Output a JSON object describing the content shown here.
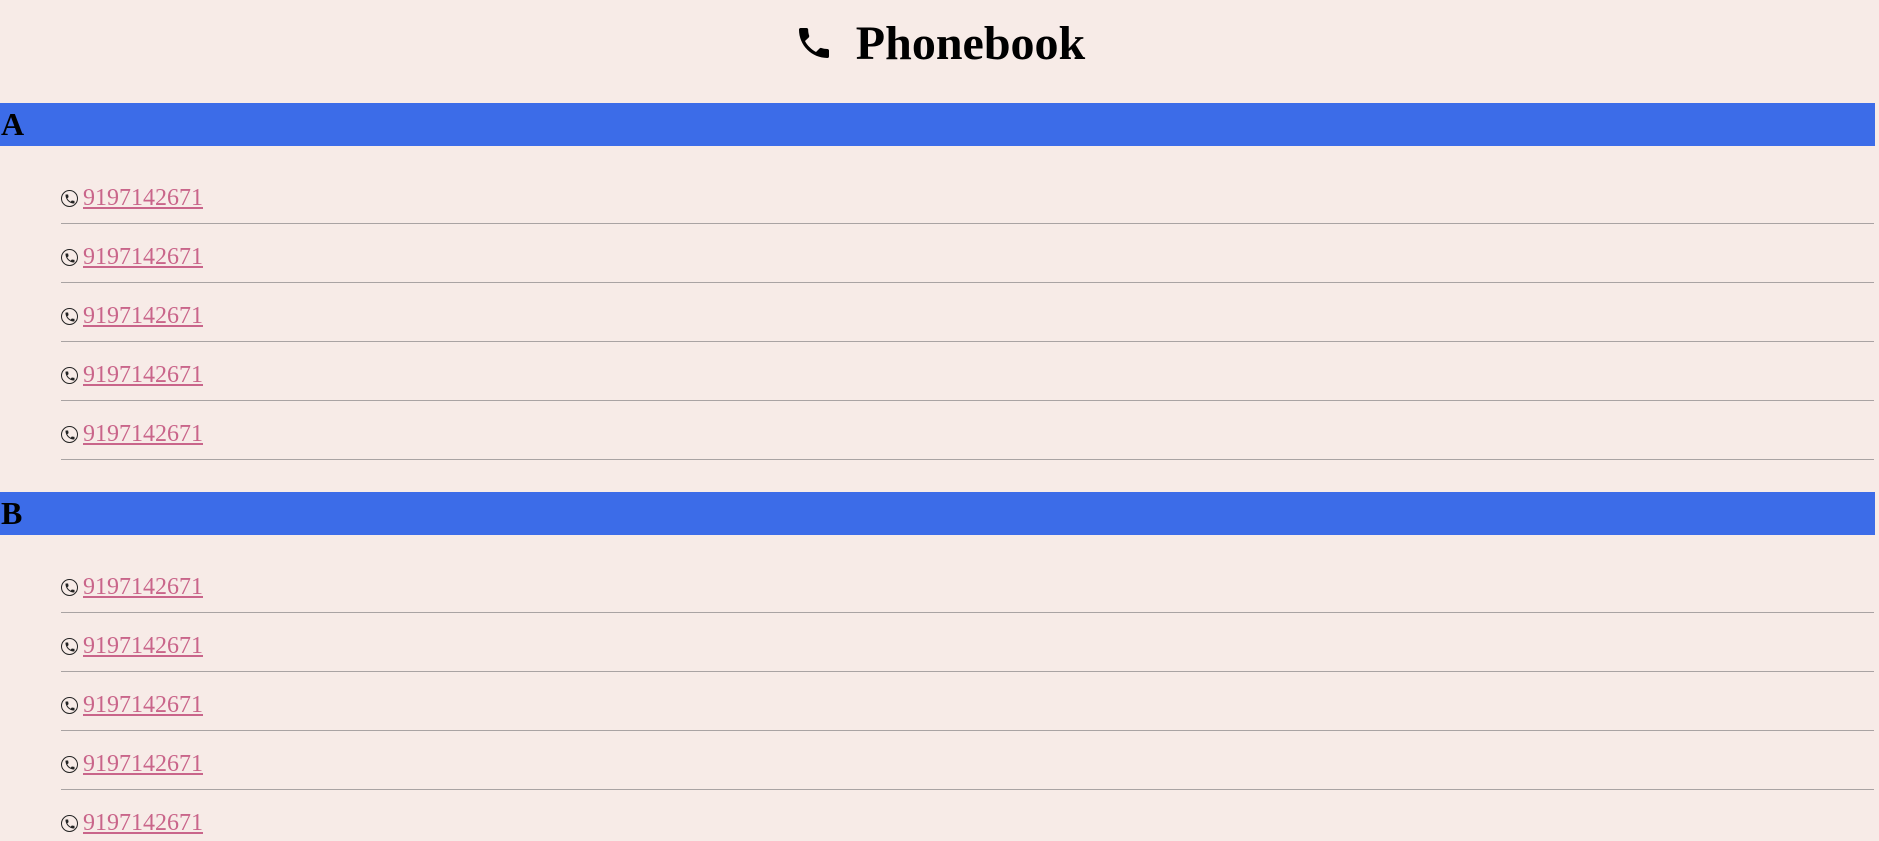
{
  "header": {
    "title": "Phonebook",
    "icon": "telephone-icon"
  },
  "colors": {
    "background": "#f7ebe7",
    "section_header": "#3c6ce8",
    "link": "#c9658a"
  },
  "sections": [
    {
      "letter": "A",
      "contacts": [
        "9197142671",
        "9197142671",
        "9197142671",
        "9197142671",
        "9197142671"
      ]
    },
    {
      "letter": "B",
      "contacts": [
        "9197142671",
        "9197142671",
        "9197142671",
        "9197142671",
        "9197142671"
      ]
    }
  ]
}
